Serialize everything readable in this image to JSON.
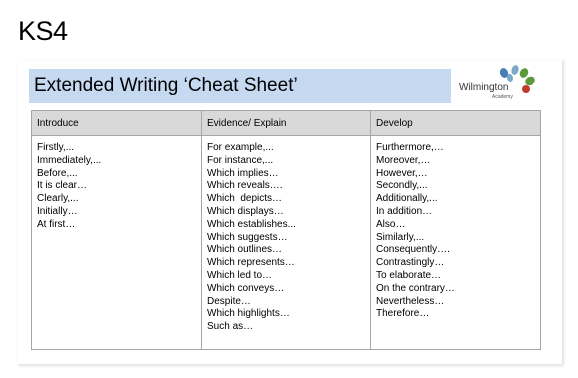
{
  "page": {
    "heading": "KS4"
  },
  "slide": {
    "title": "Extended Writing ‘Cheat Sheet’",
    "logo": {
      "name": "Wilmington",
      "subtitle": "Academy",
      "colors": [
        "#4a7fb5",
        "#5a9a3c",
        "#c0392b",
        "#7fa9c9"
      ]
    },
    "colors": {
      "title_bar": "#c5d9f1",
      "header_row": "#d9d9d9",
      "grid_lines": "#a6a6a6"
    }
  },
  "table": {
    "columns": [
      {
        "header": "Introduce",
        "items": [
          "Firstly,...",
          "Immediately,...",
          "Before,...",
          "It is clear…",
          "Clearly,...",
          "Initially…",
          "At first…"
        ]
      },
      {
        "header": "Evidence/ Explain",
        "items": [
          "For example,...",
          "For instance,...",
          "Which implies…",
          "Which reveals….",
          "Which  depicts…",
          "Which displays…",
          "Which establishes...",
          "Which suggests…",
          "Which outlines…",
          "Which represents…",
          "Which led to…",
          "Which conveys…",
          "Despite…",
          "Which highlights…",
          "Such as…"
        ]
      },
      {
        "header": "Develop",
        "items": [
          "Furthermore,…",
          "Moreover,…",
          "However,…",
          "Secondly,...",
          "Additionally,...",
          "In addition…",
          "Also…",
          "Similarly,...",
          "Consequently….",
          "Contrastingly…",
          "To elaborate…",
          "On the contrary…",
          "Nevertheless…",
          "Therefore…"
        ]
      }
    ]
  }
}
